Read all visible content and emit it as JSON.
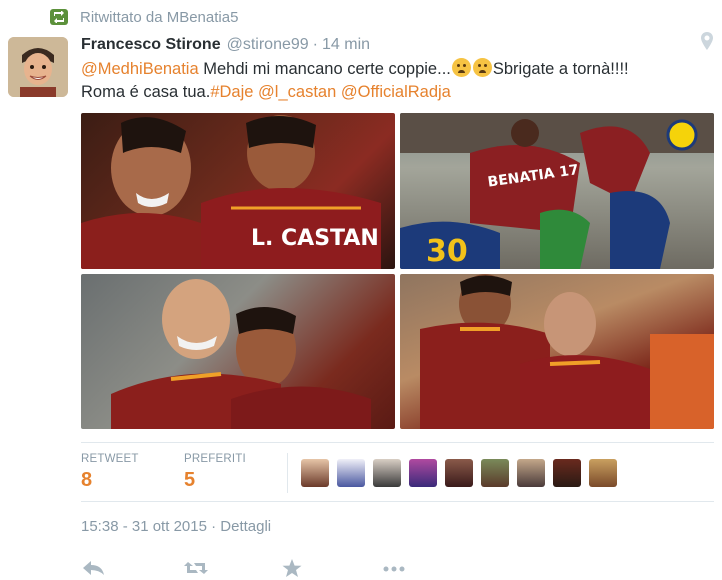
{
  "retweet_context": {
    "text": "Ritwittato da MBenatia5"
  },
  "tweet": {
    "fullname": "Francesco Stirone",
    "username": "@stirone99",
    "separator": "·",
    "time": "14 min",
    "text": {
      "mention1": "@MedhiBenatia",
      "part1": " Mehdi mi mancano certe coppie...",
      "part2": "Sbrigate a tornà!!!!",
      "part3": "Roma é casa tua.",
      "hashtag": "#Daje",
      "mention2": "@l_castan",
      "mention3": "@OfficialRadja"
    },
    "photos": [
      {
        "id": "photo-1",
        "jersey_text": "L. CASTAN"
      },
      {
        "id": "photo-2",
        "jersey_text": "BENATIA 17"
      },
      {
        "id": "photo-3"
      },
      {
        "id": "photo-4"
      }
    ]
  },
  "stats": {
    "retweets_label": "RETWEET",
    "retweets_count": "8",
    "favorites_label": "PREFERITI",
    "favorites_count": "5"
  },
  "timestamp": {
    "datetime": "15:38 - 31 ott 2015",
    "separator": "·",
    "details": "Dettagli"
  },
  "colors": {
    "link": "#e6822e",
    "muted": "#8899a6",
    "retweet_green": "#5c913b",
    "text": "#292f33"
  },
  "icons": [
    "retweet-context-icon",
    "location-pin-icon",
    "reply-icon",
    "retweet-icon",
    "favorite-star-icon",
    "more-icon"
  ]
}
